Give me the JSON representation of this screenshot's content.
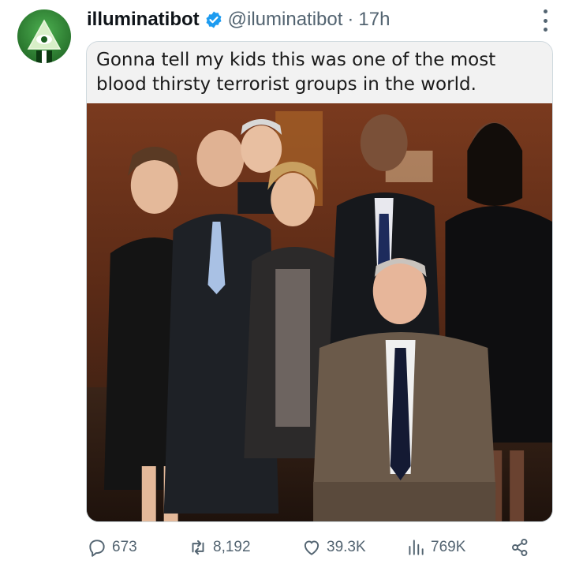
{
  "post": {
    "display_name": "illuminatibot",
    "handle": "@iluminatibot",
    "separator": "·",
    "time": "17h",
    "avatar_icon": "illuminati-eye-pyramid",
    "verified_color": "#1d9bf0"
  },
  "meme": {
    "caption_line1": "Gonna tell my kids this was one of the most",
    "caption_line2": "blood thirsty terrorist groups in the world."
  },
  "actions": {
    "replies": "673",
    "reposts": "8,192",
    "likes": "39.3K",
    "views": "769K"
  },
  "colors": {
    "text_primary": "#0f1419",
    "text_secondary": "#536471",
    "border": "#cfd9de"
  }
}
